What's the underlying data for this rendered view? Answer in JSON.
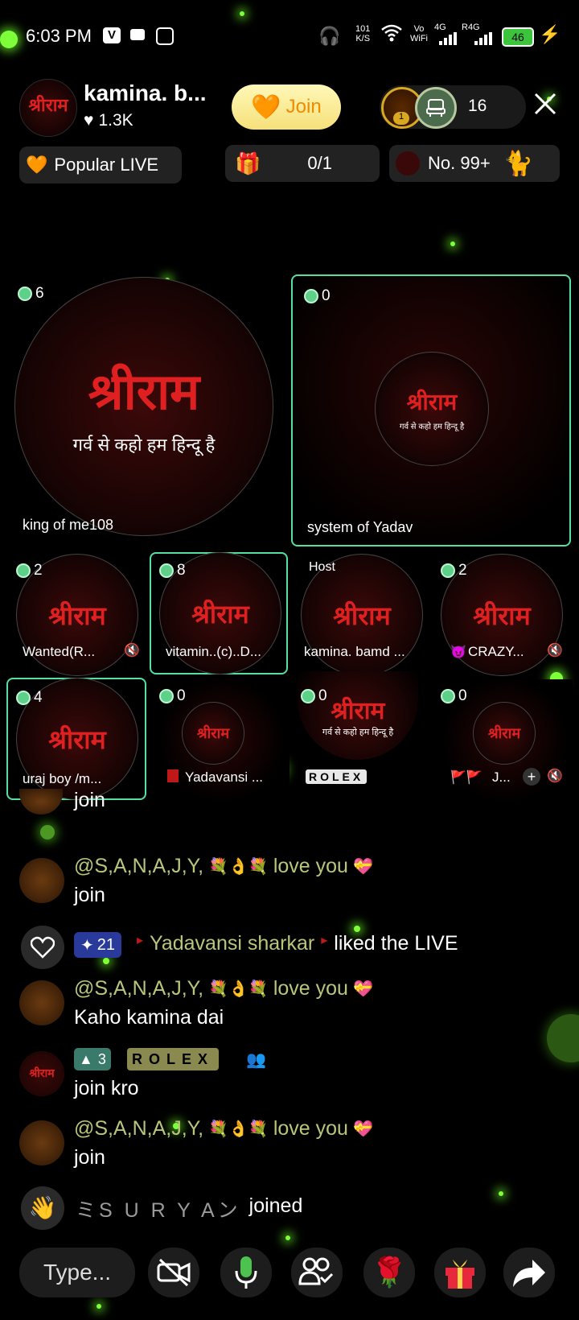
{
  "status_bar": {
    "time": "6:03 PM",
    "net_speed_top": "101",
    "net_speed_unit": "K/S",
    "volte_top": "Vo",
    "volte_bottom": "WiFi",
    "net1": "4G",
    "net2": "R4G",
    "battery": "46"
  },
  "header": {
    "room_name": "kamina. b...",
    "likes": "1.3K",
    "join_label": "Join",
    "viewer_count": "16",
    "viewer_badge": "1"
  },
  "info_bar": {
    "popular_label": "Popular LIVE",
    "progress": "0/1",
    "rank": "No. 99+"
  },
  "logo": {
    "big": "श्रीराम",
    "tagline": "गर्व से कहो हम हिन्दू है"
  },
  "seats_large": [
    {
      "count": "6",
      "name": "king of me108"
    },
    {
      "count": "0",
      "name": "system of Yadav"
    }
  ],
  "seats_row1": [
    {
      "count": "2",
      "name": "Wanted(R..."
    },
    {
      "count": "8",
      "name": "vitamin..(c)..D..."
    },
    {
      "count": "Host",
      "name": "kamina. bamd ..."
    },
    {
      "count": "2",
      "name": "CRAZY..."
    }
  ],
  "seats_row2": [
    {
      "count": "4",
      "name": "uraj boy /m..."
    },
    {
      "count": "0",
      "name": "Yadavansi ..."
    },
    {
      "count": "0",
      "name": "ROLEX"
    },
    {
      "count": "0",
      "name": "J..."
    }
  ],
  "chat": {
    "m0_text": "join",
    "m1_user": "@S,A,N,A,J,Y,",
    "m1_suffix": "love you",
    "m1_text": "join",
    "like_level": "21",
    "like_user": "Yadavansi sharkar",
    "like_text": "liked the LIVE",
    "m2_user": "@S,A,N,A,J,Y,",
    "m2_suffix": "love you",
    "m2_text": "Kaho kamina dai",
    "m3_level": "3",
    "m3_user": "ROLEX",
    "m3_text": "join kro",
    "m4_user": "@S,A,N,A,J,Y,",
    "m4_suffix": "love you",
    "m4_text": "join",
    "joined_user": "ミS U R Y Aン",
    "joined_text": "joined"
  },
  "bottom_bar": {
    "type_placeholder": "Type..."
  },
  "colors": {
    "accent_green": "#56e0a0",
    "bokeh": "#7dff3a",
    "logo_red": "#e02020"
  }
}
